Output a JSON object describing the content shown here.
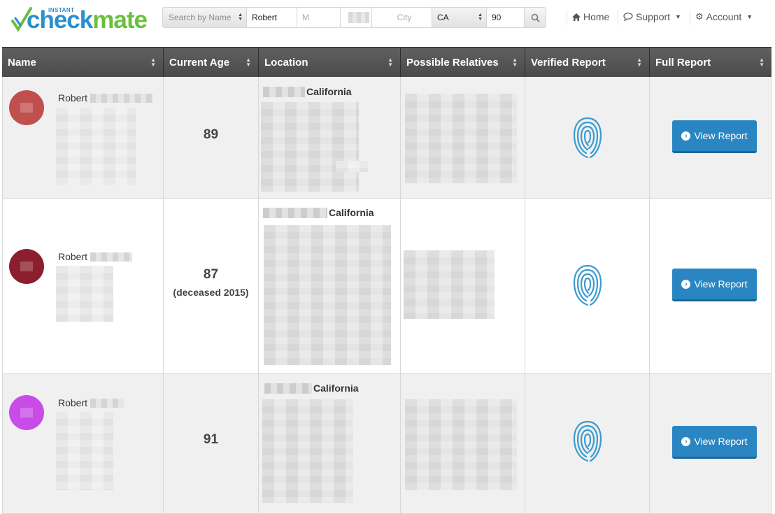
{
  "brand": {
    "small": "INSTANT",
    "check": "check",
    "mate": "mate",
    "accent": "#2a8fcf",
    "green": "#6abf3b"
  },
  "search": {
    "type_label": "Search by Name",
    "first_name": "Robert",
    "middle_placeholder": "M",
    "city_placeholder": "City",
    "state": "CA",
    "age": "90",
    "search_icon": "search-icon"
  },
  "nav": {
    "home": "Home",
    "support": "Support",
    "account": "Account"
  },
  "table": {
    "headers": [
      "Name",
      "Current Age",
      "Location",
      "Possible Relatives",
      "Verified Report",
      "Full Report"
    ],
    "rows": [
      {
        "first_name": "Robert",
        "age": "89",
        "deceased": "",
        "state": "California",
        "avatar_color": "#c0504d",
        "button": "View Report"
      },
      {
        "first_name": "Robert",
        "age": "87",
        "deceased": "(deceased 2015)",
        "state": "California",
        "avatar_color": "#8c1f2e",
        "button": "View Report"
      },
      {
        "first_name": "Robert",
        "age": "91",
        "deceased": "",
        "state": "California",
        "avatar_color": "#c94be8",
        "button": "View Report"
      }
    ]
  },
  "colors": {
    "header_bg": "#555555",
    "button": "#2a86c2",
    "fingerprint": "#3a9bcf"
  }
}
